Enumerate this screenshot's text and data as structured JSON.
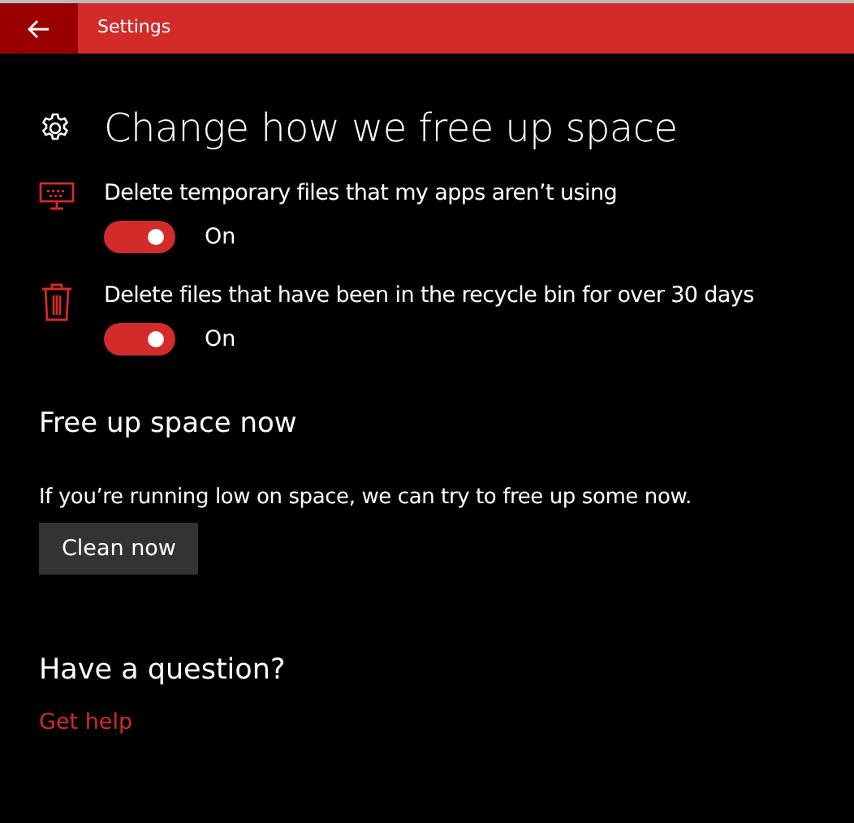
{
  "window": {
    "title": "Settings"
  },
  "page": {
    "title": "Change how we free up space"
  },
  "settings": [
    {
      "label": "Delete temporary files that my apps aren’t using",
      "on": true,
      "state_text": "On"
    },
    {
      "label": "Delete files that have been in the recycle bin for over 30 days",
      "on": true,
      "state_text": "On"
    }
  ],
  "free_up": {
    "heading": "Free up space now",
    "description": "If you’re running low on space, we can try to free up some now.",
    "button": "Clean now"
  },
  "help": {
    "heading": "Have a question?",
    "link": "Get help"
  }
}
